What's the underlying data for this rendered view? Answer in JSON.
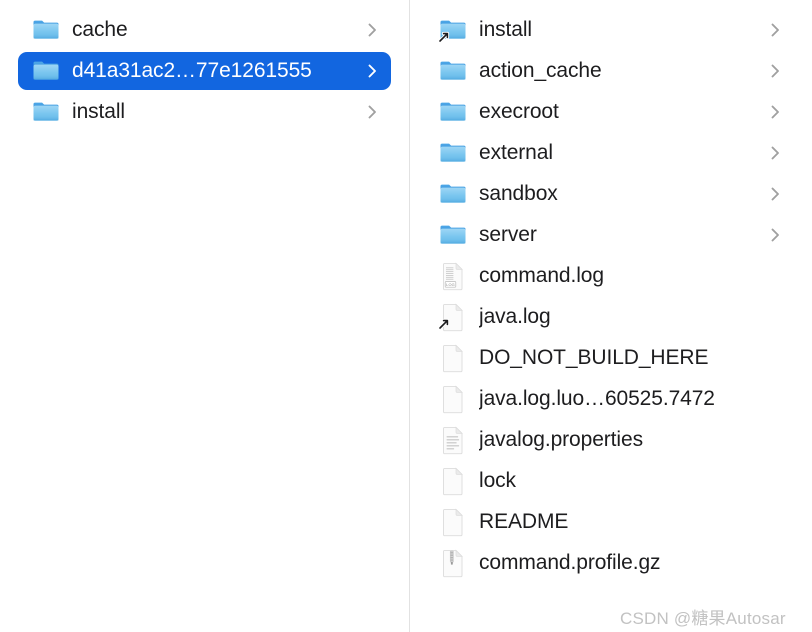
{
  "view": {
    "kind": "finder-column-view",
    "selection_color": "#1266e0",
    "text_color": "#1d1d1f",
    "selected_text_color": "#ffffff",
    "chevron_color": "#a0a0a0",
    "divider_color": "#e2e2e2",
    "background": "#ffffff"
  },
  "columns": [
    {
      "name": "parent-column",
      "items": [
        {
          "label": "cache",
          "icon": "folder-icon",
          "badge": "none",
          "has_chevron": true,
          "selected": false
        },
        {
          "label": "d41a31ac2…77e1261555",
          "icon": "folder-icon",
          "badge": "none",
          "has_chevron": true,
          "selected": true
        },
        {
          "label": "install",
          "icon": "folder-icon",
          "badge": "none",
          "has_chevron": true,
          "selected": false
        }
      ]
    },
    {
      "name": "child-column",
      "items": [
        {
          "label": "install",
          "icon": "folder-icon",
          "badge": "alias",
          "has_chevron": true,
          "selected": false
        },
        {
          "label": "action_cache",
          "icon": "folder-icon",
          "badge": "none",
          "has_chevron": true,
          "selected": false
        },
        {
          "label": "execroot",
          "icon": "folder-icon",
          "badge": "none",
          "has_chevron": true,
          "selected": false
        },
        {
          "label": "external",
          "icon": "folder-icon",
          "badge": "none",
          "has_chevron": true,
          "selected": false
        },
        {
          "label": "sandbox",
          "icon": "folder-icon",
          "badge": "none",
          "has_chevron": true,
          "selected": false
        },
        {
          "label": "server",
          "icon": "folder-icon",
          "badge": "none",
          "has_chevron": true,
          "selected": false
        },
        {
          "label": "command.log",
          "icon": "log-document-icon",
          "badge": "none",
          "has_chevron": false,
          "selected": false
        },
        {
          "label": "java.log",
          "icon": "blank-document-icon",
          "badge": "alias",
          "has_chevron": false,
          "selected": false
        },
        {
          "label": "DO_NOT_BUILD_HERE",
          "icon": "blank-document-icon",
          "badge": "none",
          "has_chevron": false,
          "selected": false
        },
        {
          "label": "java.log.luo…60525.7472",
          "icon": "blank-document-icon",
          "badge": "none",
          "has_chevron": false,
          "selected": false
        },
        {
          "label": "javalog.properties",
          "icon": "text-document-icon",
          "badge": "none",
          "has_chevron": false,
          "selected": false
        },
        {
          "label": "lock",
          "icon": "blank-document-icon",
          "badge": "none",
          "has_chevron": false,
          "selected": false
        },
        {
          "label": "README",
          "icon": "blank-document-icon",
          "badge": "none",
          "has_chevron": false,
          "selected": false
        },
        {
          "label": "command.profile.gz",
          "icon": "archive-document-icon",
          "badge": "none",
          "has_chevron": false,
          "selected": false
        }
      ]
    }
  ],
  "watermark": {
    "text": "CSDN @糖果Autosar"
  }
}
